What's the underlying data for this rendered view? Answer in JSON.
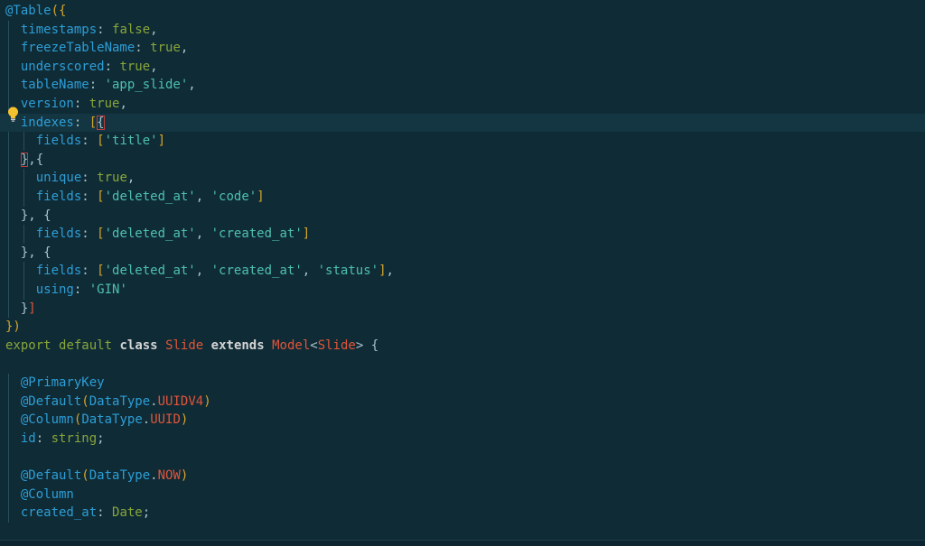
{
  "colors": {
    "background": "#0f2b36",
    "default": "#a9c3ca",
    "decorator": "#2d9ed6",
    "property": "#2d9ed6",
    "string": "#4ec0b0",
    "keyword": "#88a63a",
    "keyword_bold": "#d4d4d4",
    "class_name": "#e0553a",
    "bracket": "#d4a52b",
    "const": "#e0553a",
    "number": "#88a63a",
    "type": "#88a63a"
  },
  "lines": [
    [
      {
        "t": "@Table",
        "c": "decorator"
      },
      {
        "t": "({",
        "c": "bracket"
      }
    ],
    [
      {
        "t": "  "
      },
      {
        "t": "timestamps",
        "c": "property"
      },
      {
        "t": ": ",
        "c": "default"
      },
      {
        "t": "false",
        "c": "keyword"
      },
      {
        "t": ",",
        "c": "default"
      }
    ],
    [
      {
        "t": "  "
      },
      {
        "t": "freezeTableName",
        "c": "property"
      },
      {
        "t": ": ",
        "c": "default"
      },
      {
        "t": "true",
        "c": "keyword"
      },
      {
        "t": ",",
        "c": "default"
      }
    ],
    [
      {
        "t": "  "
      },
      {
        "t": "underscored",
        "c": "property"
      },
      {
        "t": ": ",
        "c": "default"
      },
      {
        "t": "true",
        "c": "keyword"
      },
      {
        "t": ",",
        "c": "default"
      }
    ],
    [
      {
        "t": "  "
      },
      {
        "t": "tableName",
        "c": "property"
      },
      {
        "t": ": ",
        "c": "default"
      },
      {
        "t": "'app_slide'",
        "c": "string"
      },
      {
        "t": ",",
        "c": "default"
      }
    ],
    [
      {
        "t": "  "
      },
      {
        "t": "version",
        "c": "property"
      },
      {
        "t": ": ",
        "c": "default"
      },
      {
        "t": "true",
        "c": "keyword"
      },
      {
        "t": ",",
        "c": "default"
      }
    ],
    [
      {
        "t": "  "
      },
      {
        "t": "indexes",
        "c": "property"
      },
      {
        "t": ": ",
        "c": "default"
      },
      {
        "t": "[",
        "c": "bracket"
      },
      {
        "t": "{",
        "c": "default",
        "box": true
      }
    ],
    [
      {
        "t": "    "
      },
      {
        "t": "fields",
        "c": "property"
      },
      {
        "t": ": ",
        "c": "default"
      },
      {
        "t": "[",
        "c": "bracket"
      },
      {
        "t": "'title'",
        "c": "string"
      },
      {
        "t": "]",
        "c": "bracket"
      }
    ],
    [
      {
        "t": "  "
      },
      {
        "t": "}",
        "c": "default",
        "box": true
      },
      {
        "t": ",{",
        "c": "default"
      }
    ],
    [
      {
        "t": "    "
      },
      {
        "t": "unique",
        "c": "property"
      },
      {
        "t": ": ",
        "c": "default"
      },
      {
        "t": "true",
        "c": "keyword"
      },
      {
        "t": ",",
        "c": "default"
      }
    ],
    [
      {
        "t": "    "
      },
      {
        "t": "fields",
        "c": "property"
      },
      {
        "t": ": ",
        "c": "default"
      },
      {
        "t": "[",
        "c": "bracket"
      },
      {
        "t": "'deleted_at'",
        "c": "string"
      },
      {
        "t": ", ",
        "c": "default"
      },
      {
        "t": "'code'",
        "c": "string"
      },
      {
        "t": "]",
        "c": "bracket"
      }
    ],
    [
      {
        "t": "  "
      },
      {
        "t": "}, {",
        "c": "default"
      }
    ],
    [
      {
        "t": "    "
      },
      {
        "t": "fields",
        "c": "property"
      },
      {
        "t": ": ",
        "c": "default"
      },
      {
        "t": "[",
        "c": "bracket"
      },
      {
        "t": "'deleted_at'",
        "c": "string"
      },
      {
        "t": ", ",
        "c": "default"
      },
      {
        "t": "'created_at'",
        "c": "string"
      },
      {
        "t": "]",
        "c": "bracket"
      }
    ],
    [
      {
        "t": "  "
      },
      {
        "t": "}, {",
        "c": "default"
      }
    ],
    [
      {
        "t": "    "
      },
      {
        "t": "fields",
        "c": "property"
      },
      {
        "t": ": ",
        "c": "default"
      },
      {
        "t": "[",
        "c": "bracket"
      },
      {
        "t": "'deleted_at'",
        "c": "string"
      },
      {
        "t": ", ",
        "c": "default"
      },
      {
        "t": "'created_at'",
        "c": "string"
      },
      {
        "t": ", ",
        "c": "default"
      },
      {
        "t": "'status'",
        "c": "string"
      },
      {
        "t": "]",
        "c": "bracket"
      },
      {
        "t": ",",
        "c": "default"
      }
    ],
    [
      {
        "t": "    "
      },
      {
        "t": "using",
        "c": "property"
      },
      {
        "t": ": ",
        "c": "default"
      },
      {
        "t": "'GIN'",
        "c": "string"
      }
    ],
    [
      {
        "t": "  "
      },
      {
        "t": "}",
        "c": "default"
      },
      {
        "t": "]",
        "c": "const"
      }
    ],
    [
      {
        "t": "})",
        "c": "bracket"
      }
    ],
    [
      {
        "t": "export",
        "c": "keyword"
      },
      {
        "t": " "
      },
      {
        "t": "default",
        "c": "keyword"
      },
      {
        "t": " "
      },
      {
        "t": "class",
        "c": "keyword_bold"
      },
      {
        "t": " "
      },
      {
        "t": "Slide",
        "c": "class_name"
      },
      {
        "t": " "
      },
      {
        "t": "extends",
        "c": "keyword_bold"
      },
      {
        "t": " "
      },
      {
        "t": "Model",
        "c": "class_name"
      },
      {
        "t": "<",
        "c": "default"
      },
      {
        "t": "Slide",
        "c": "class_name"
      },
      {
        "t": "> {",
        "c": "default"
      }
    ],
    [
      {
        "t": ""
      }
    ],
    [
      {
        "t": "  "
      },
      {
        "t": "@PrimaryKey",
        "c": "decorator"
      }
    ],
    [
      {
        "t": "  "
      },
      {
        "t": "@Default",
        "c": "decorator"
      },
      {
        "t": "(",
        "c": "bracket"
      },
      {
        "t": "DataType",
        "c": "decorator"
      },
      {
        "t": ".",
        "c": "default"
      },
      {
        "t": "UUIDV4",
        "c": "const"
      },
      {
        "t": ")",
        "c": "bracket"
      }
    ],
    [
      {
        "t": "  "
      },
      {
        "t": "@Column",
        "c": "decorator"
      },
      {
        "t": "(",
        "c": "bracket"
      },
      {
        "t": "DataType",
        "c": "decorator"
      },
      {
        "t": ".",
        "c": "default"
      },
      {
        "t": "UUID",
        "c": "const"
      },
      {
        "t": ")",
        "c": "bracket"
      }
    ],
    [
      {
        "t": "  "
      },
      {
        "t": "id",
        "c": "property"
      },
      {
        "t": ": ",
        "c": "default"
      },
      {
        "t": "string",
        "c": "type"
      },
      {
        "t": ";",
        "c": "default"
      }
    ],
    [
      {
        "t": ""
      }
    ],
    [
      {
        "t": "  "
      },
      {
        "t": "@Default",
        "c": "decorator"
      },
      {
        "t": "(",
        "c": "bracket"
      },
      {
        "t": "DataType",
        "c": "decorator"
      },
      {
        "t": ".",
        "c": "default"
      },
      {
        "t": "NOW",
        "c": "const"
      },
      {
        "t": ")",
        "c": "bracket"
      }
    ],
    [
      {
        "t": "  "
      },
      {
        "t": "@Column",
        "c": "decorator"
      }
    ],
    [
      {
        "t": "  "
      },
      {
        "t": "created_at",
        "c": "property"
      },
      {
        "t": ": ",
        "c": "default"
      },
      {
        "t": "Date",
        "c": "type"
      },
      {
        "t": ";",
        "c": "default"
      }
    ]
  ],
  "current_line": 6,
  "lightbulb_line": 5,
  "icons": {
    "lightbulb": "lightbulb-icon"
  }
}
